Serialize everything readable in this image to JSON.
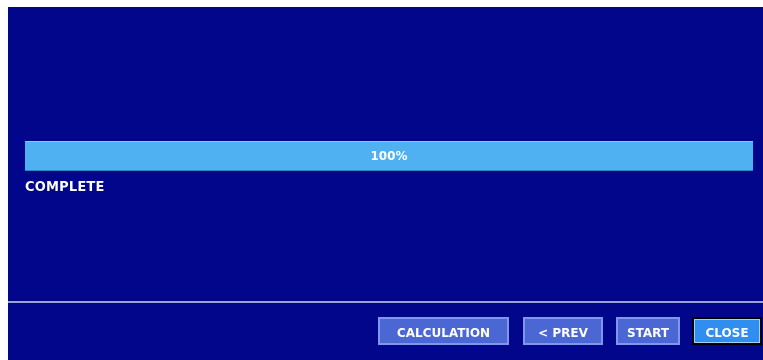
{
  "progress": {
    "value": 100,
    "label": "100%",
    "fill_color": "#4fb0f2"
  },
  "status": {
    "text": "COMPLETE"
  },
  "buttons": {
    "calculation": "CALCULATION",
    "prev": "< PREV",
    "start": "START",
    "close": "CLOSE"
  },
  "colors": {
    "background": "#02068a",
    "button": "#4a67d4",
    "button_active": "#2f8ef0"
  }
}
